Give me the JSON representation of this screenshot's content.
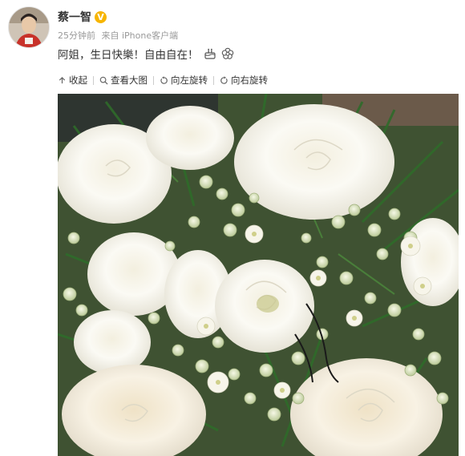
{
  "post": {
    "username": "蔡一智",
    "verified_badge": "V",
    "time": "25分钟前",
    "source": "来自 iPhone客户端",
    "text": "阿姐，生日快樂！自由自在！",
    "emojis": [
      "cake-icon",
      "flower-icon"
    ]
  },
  "toolbar": {
    "collapse": "收起",
    "view_large": "查看大图",
    "rotate_left": "向左旋转",
    "rotate_right": "向右旋转"
  },
  "colors": {
    "verified": "#f7b500",
    "meta_text": "#999999",
    "main_text": "#333333"
  }
}
